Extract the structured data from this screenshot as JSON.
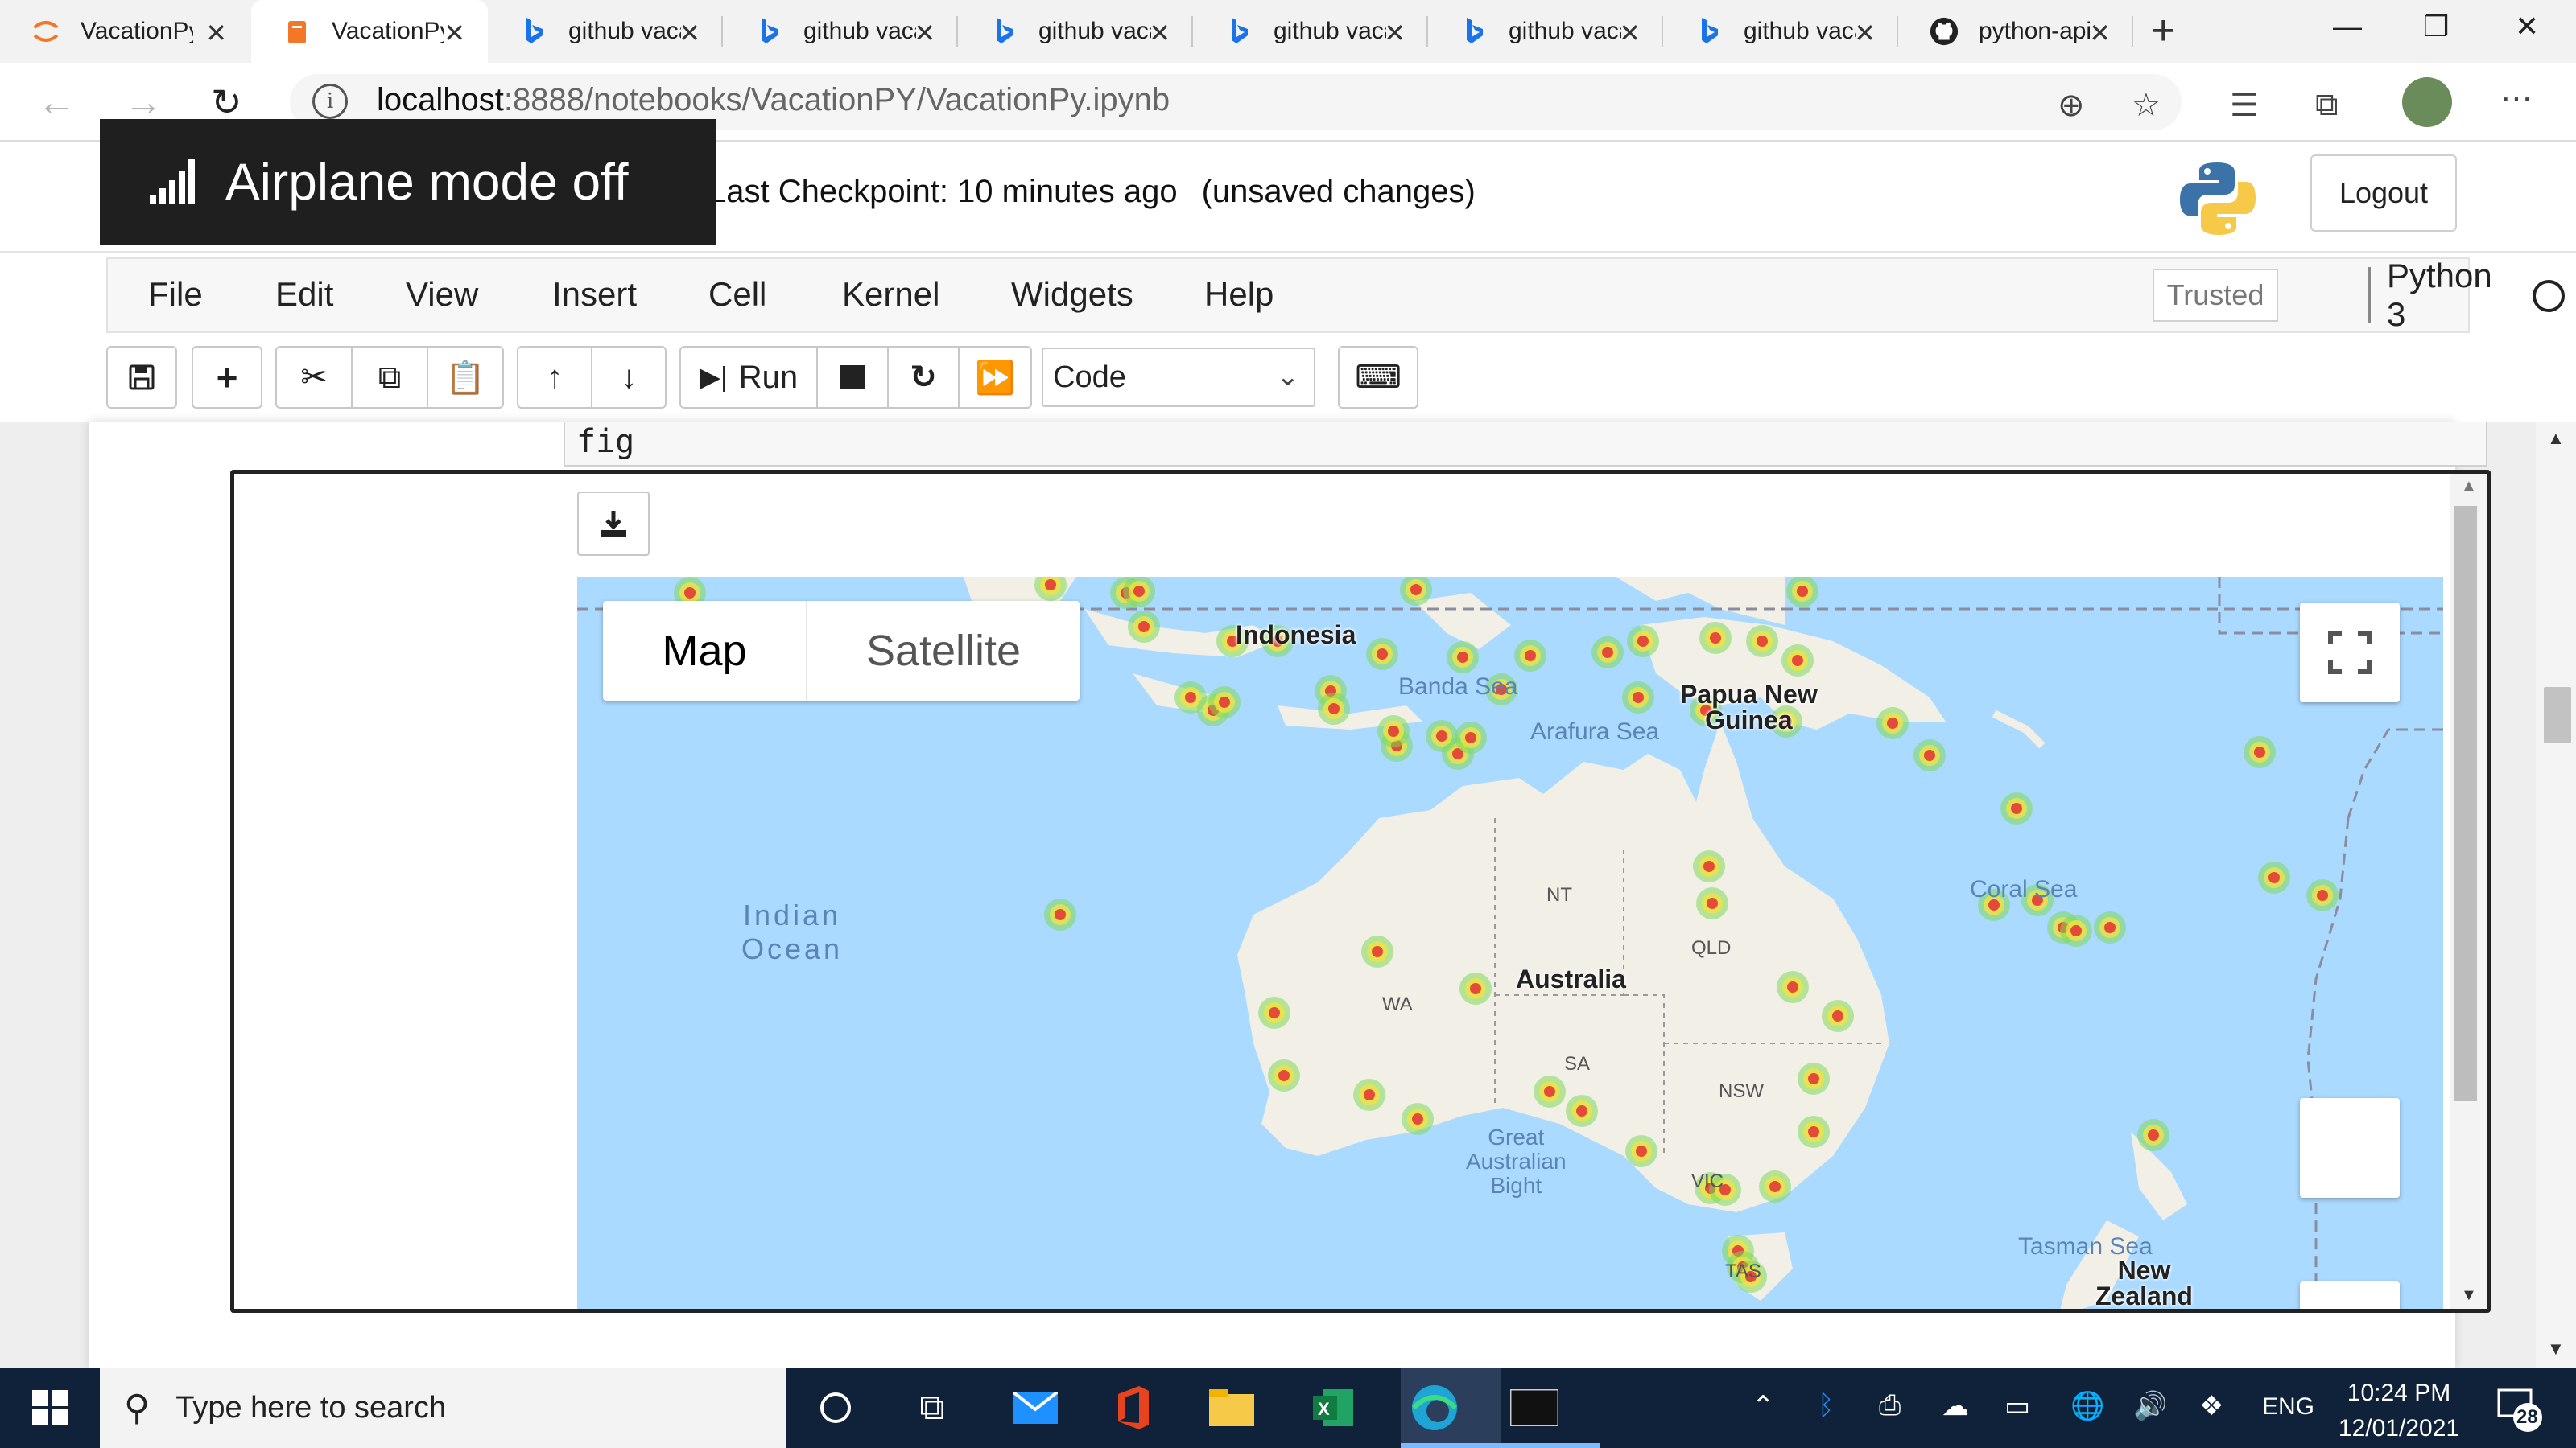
{
  "browser": {
    "tabs": [
      {
        "title": "VacationPy",
        "favicon": "jupyter-icon",
        "active": false
      },
      {
        "title": "VacationPy",
        "favicon": "notebook-icon",
        "active": true
      },
      {
        "title": "github vacation",
        "favicon": "bing-icon",
        "active": false
      },
      {
        "title": "github vacation",
        "favicon": "bing-icon",
        "active": false
      },
      {
        "title": "github vacation",
        "favicon": "bing-icon",
        "active": false
      },
      {
        "title": "github vacation",
        "favicon": "bing-icon",
        "active": false
      },
      {
        "title": "github vacation",
        "favicon": "bing-icon",
        "active": false
      },
      {
        "title": "github vacation",
        "favicon": "bing-icon",
        "active": false
      },
      {
        "title": "python-api",
        "favicon": "github-icon",
        "active": false
      }
    ],
    "url_host": "localhost",
    "url_path": ":8888/notebooks/VacationPY/VacationPy.ipynb"
  },
  "toast": {
    "text": "Airplane mode off"
  },
  "jupyter": {
    "checkpoint": "Last Checkpoint: 10 minutes ago",
    "unsaved": "(unsaved changes)",
    "logout": "Logout",
    "menu": [
      "File",
      "Edit",
      "View",
      "Insert",
      "Cell",
      "Kernel",
      "Widgets",
      "Help"
    ],
    "trusted": "Trusted",
    "kernel": "Python 3",
    "run_label": "Run",
    "cell_type": "Code",
    "code_line": "fig"
  },
  "map": {
    "map_btn": "Map",
    "satellite_btn": "Satellite",
    "labels": {
      "indian_ocean_1": "Indian",
      "indian_ocean_2": "Ocean",
      "indonesia": "Indonesia",
      "banda_sea": "Banda Sea",
      "arafura_sea": "Arafura Sea",
      "png_1": "Papua New",
      "png_2": "Guinea",
      "coral_sea": "Coral Sea",
      "nt": "NT",
      "qld": "QLD",
      "wa": "WA",
      "australia": "Australia",
      "sa": "SA",
      "nsw": "NSW",
      "great_1": "Great",
      "great_2": "Australian",
      "great_3": "Bight",
      "vic": "VIC",
      "tas": "TAS",
      "tasman_sea": "Tasman Sea",
      "nz_1": "New",
      "nz_2": "Zealand"
    },
    "colors": {
      "water": "#aadaff",
      "land": "#f2efe6",
      "heat_core": "#e53935",
      "heat_mid": "#f7e33b",
      "heat_outer": "#7ed957"
    }
  },
  "taskbar": {
    "search_placeholder": "Type here to search",
    "language": "ENG",
    "time": "10:24 PM",
    "date": "12/01/2021",
    "notifications": "28"
  }
}
